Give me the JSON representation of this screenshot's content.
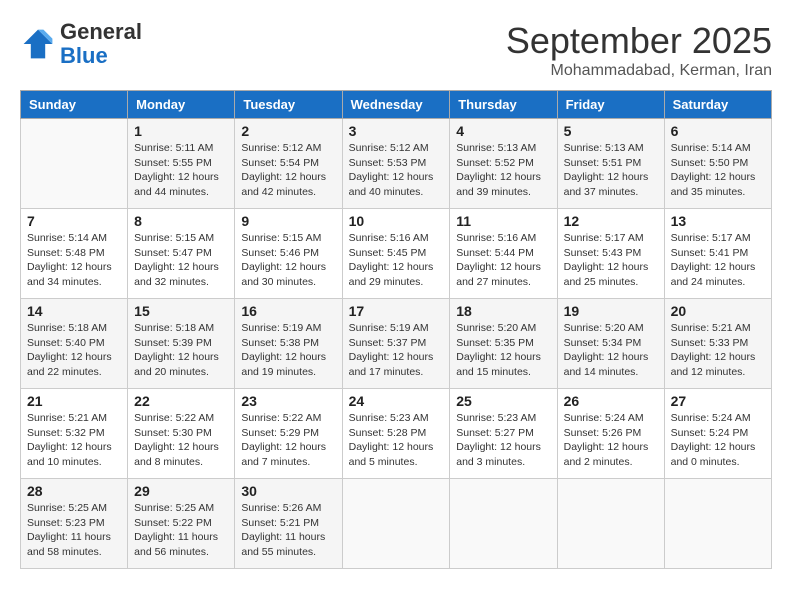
{
  "header": {
    "logo_general": "General",
    "logo_blue": "Blue",
    "month": "September 2025",
    "location": "Mohammadabad, Kerman, Iran"
  },
  "weekdays": [
    "Sunday",
    "Monday",
    "Tuesday",
    "Wednesday",
    "Thursday",
    "Friday",
    "Saturday"
  ],
  "weeks": [
    [
      {
        "day": null,
        "info": null
      },
      {
        "day": "1",
        "info": "Sunrise: 5:11 AM\nSunset: 5:55 PM\nDaylight: 12 hours\nand 44 minutes."
      },
      {
        "day": "2",
        "info": "Sunrise: 5:12 AM\nSunset: 5:54 PM\nDaylight: 12 hours\nand 42 minutes."
      },
      {
        "day": "3",
        "info": "Sunrise: 5:12 AM\nSunset: 5:53 PM\nDaylight: 12 hours\nand 40 minutes."
      },
      {
        "day": "4",
        "info": "Sunrise: 5:13 AM\nSunset: 5:52 PM\nDaylight: 12 hours\nand 39 minutes."
      },
      {
        "day": "5",
        "info": "Sunrise: 5:13 AM\nSunset: 5:51 PM\nDaylight: 12 hours\nand 37 minutes."
      },
      {
        "day": "6",
        "info": "Sunrise: 5:14 AM\nSunset: 5:50 PM\nDaylight: 12 hours\nand 35 minutes."
      }
    ],
    [
      {
        "day": "7",
        "info": "Sunrise: 5:14 AM\nSunset: 5:48 PM\nDaylight: 12 hours\nand 34 minutes."
      },
      {
        "day": "8",
        "info": "Sunrise: 5:15 AM\nSunset: 5:47 PM\nDaylight: 12 hours\nand 32 minutes."
      },
      {
        "day": "9",
        "info": "Sunrise: 5:15 AM\nSunset: 5:46 PM\nDaylight: 12 hours\nand 30 minutes."
      },
      {
        "day": "10",
        "info": "Sunrise: 5:16 AM\nSunset: 5:45 PM\nDaylight: 12 hours\nand 29 minutes."
      },
      {
        "day": "11",
        "info": "Sunrise: 5:16 AM\nSunset: 5:44 PM\nDaylight: 12 hours\nand 27 minutes."
      },
      {
        "day": "12",
        "info": "Sunrise: 5:17 AM\nSunset: 5:43 PM\nDaylight: 12 hours\nand 25 minutes."
      },
      {
        "day": "13",
        "info": "Sunrise: 5:17 AM\nSunset: 5:41 PM\nDaylight: 12 hours\nand 24 minutes."
      }
    ],
    [
      {
        "day": "14",
        "info": "Sunrise: 5:18 AM\nSunset: 5:40 PM\nDaylight: 12 hours\nand 22 minutes."
      },
      {
        "day": "15",
        "info": "Sunrise: 5:18 AM\nSunset: 5:39 PM\nDaylight: 12 hours\nand 20 minutes."
      },
      {
        "day": "16",
        "info": "Sunrise: 5:19 AM\nSunset: 5:38 PM\nDaylight: 12 hours\nand 19 minutes."
      },
      {
        "day": "17",
        "info": "Sunrise: 5:19 AM\nSunset: 5:37 PM\nDaylight: 12 hours\nand 17 minutes."
      },
      {
        "day": "18",
        "info": "Sunrise: 5:20 AM\nSunset: 5:35 PM\nDaylight: 12 hours\nand 15 minutes."
      },
      {
        "day": "19",
        "info": "Sunrise: 5:20 AM\nSunset: 5:34 PM\nDaylight: 12 hours\nand 14 minutes."
      },
      {
        "day": "20",
        "info": "Sunrise: 5:21 AM\nSunset: 5:33 PM\nDaylight: 12 hours\nand 12 minutes."
      }
    ],
    [
      {
        "day": "21",
        "info": "Sunrise: 5:21 AM\nSunset: 5:32 PM\nDaylight: 12 hours\nand 10 minutes."
      },
      {
        "day": "22",
        "info": "Sunrise: 5:22 AM\nSunset: 5:30 PM\nDaylight: 12 hours\nand 8 minutes."
      },
      {
        "day": "23",
        "info": "Sunrise: 5:22 AM\nSunset: 5:29 PM\nDaylight: 12 hours\nand 7 minutes."
      },
      {
        "day": "24",
        "info": "Sunrise: 5:23 AM\nSunset: 5:28 PM\nDaylight: 12 hours\nand 5 minutes."
      },
      {
        "day": "25",
        "info": "Sunrise: 5:23 AM\nSunset: 5:27 PM\nDaylight: 12 hours\nand 3 minutes."
      },
      {
        "day": "26",
        "info": "Sunrise: 5:24 AM\nSunset: 5:26 PM\nDaylight: 12 hours\nand 2 minutes."
      },
      {
        "day": "27",
        "info": "Sunrise: 5:24 AM\nSunset: 5:24 PM\nDaylight: 12 hours\nand 0 minutes."
      }
    ],
    [
      {
        "day": "28",
        "info": "Sunrise: 5:25 AM\nSunset: 5:23 PM\nDaylight: 11 hours\nand 58 minutes."
      },
      {
        "day": "29",
        "info": "Sunrise: 5:25 AM\nSunset: 5:22 PM\nDaylight: 11 hours\nand 56 minutes."
      },
      {
        "day": "30",
        "info": "Sunrise: 5:26 AM\nSunset: 5:21 PM\nDaylight: 11 hours\nand 55 minutes."
      },
      {
        "day": null,
        "info": null
      },
      {
        "day": null,
        "info": null
      },
      {
        "day": null,
        "info": null
      },
      {
        "day": null,
        "info": null
      }
    ]
  ]
}
